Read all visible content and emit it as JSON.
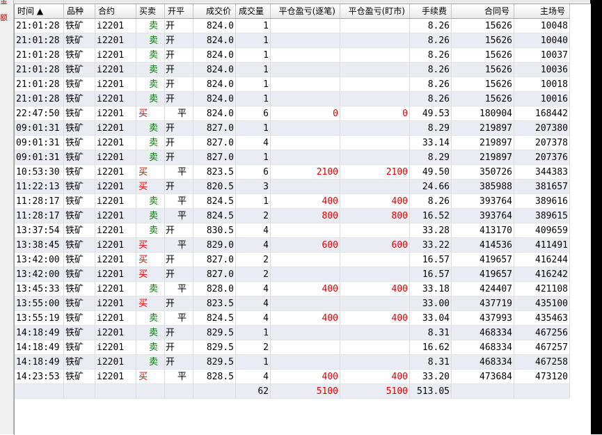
{
  "left_strip_chars": [
    "金",
    "额"
  ],
  "columns": [
    {
      "key": "time",
      "label": "时间 ▲",
      "w": 71,
      "align": "hl"
    },
    {
      "key": "variety",
      "label": "品种",
      "w": 45,
      "align": "hl"
    },
    {
      "key": "contract",
      "label": "合约",
      "w": 59,
      "align": "hl"
    },
    {
      "key": "bs",
      "label": "买卖",
      "w": 41,
      "align": "hl"
    },
    {
      "key": "oc",
      "label": "开平",
      "w": 41,
      "align": "hl"
    },
    {
      "key": "price",
      "label": "成交价",
      "w": 61,
      "align": "hr"
    },
    {
      "key": "qty",
      "label": "成交量",
      "w": 50,
      "align": "hl"
    },
    {
      "key": "pnl_trade",
      "label": "平仓盈亏(逐笔)",
      "w": 100,
      "align": "hr"
    },
    {
      "key": "pnl_mark",
      "label": "平仓盈亏(盯市)",
      "w": 100,
      "align": "hr"
    },
    {
      "key": "fee",
      "label": "手续费",
      "w": 60,
      "align": "hr"
    },
    {
      "key": "order_no",
      "label": "合同号",
      "w": 90,
      "align": "hr"
    },
    {
      "key": "venue_no",
      "label": "主场号",
      "w": 80,
      "align": "hr"
    }
  ],
  "rows": [
    {
      "time": "21:01:28",
      "variety": "铁矿",
      "contract": "i2201",
      "bs": "卖",
      "oc": "开",
      "price": "824.0",
      "qty": "1",
      "pnl_trade": "",
      "pnl_mark": "",
      "fee": "8.26",
      "order_no": "15626",
      "venue_no": "10048"
    },
    {
      "time": "21:01:28",
      "variety": "铁矿",
      "contract": "i2201",
      "bs": "卖",
      "oc": "开",
      "price": "824.0",
      "qty": "1",
      "pnl_trade": "",
      "pnl_mark": "",
      "fee": "8.26",
      "order_no": "15626",
      "venue_no": "10040"
    },
    {
      "time": "21:01:28",
      "variety": "铁矿",
      "contract": "i2201",
      "bs": "卖",
      "oc": "开",
      "price": "824.0",
      "qty": "1",
      "pnl_trade": "",
      "pnl_mark": "",
      "fee": "8.26",
      "order_no": "15626",
      "venue_no": "10037"
    },
    {
      "time": "21:01:28",
      "variety": "铁矿",
      "contract": "i2201",
      "bs": "卖",
      "oc": "开",
      "price": "824.0",
      "qty": "1",
      "pnl_trade": "",
      "pnl_mark": "",
      "fee": "8.26",
      "order_no": "15626",
      "venue_no": "10036"
    },
    {
      "time": "21:01:28",
      "variety": "铁矿",
      "contract": "i2201",
      "bs": "卖",
      "oc": "开",
      "price": "824.0",
      "qty": "1",
      "pnl_trade": "",
      "pnl_mark": "",
      "fee": "8.26",
      "order_no": "15626",
      "venue_no": "10018"
    },
    {
      "time": "21:01:28",
      "variety": "铁矿",
      "contract": "i2201",
      "bs": "卖",
      "oc": "开",
      "price": "824.0",
      "qty": "1",
      "pnl_trade": "",
      "pnl_mark": "",
      "fee": "8.26",
      "order_no": "15626",
      "venue_no": "10016"
    },
    {
      "time": "22:47:50",
      "variety": "铁矿",
      "contract": "i2201",
      "bs": "买",
      "oc": "平",
      "price": "824.0",
      "qty": "6",
      "pnl_trade": "0",
      "pnl_mark": "0",
      "fee": "49.53",
      "order_no": "180904",
      "venue_no": "168442"
    },
    {
      "time": "09:01:31",
      "variety": "铁矿",
      "contract": "i2201",
      "bs": "卖",
      "oc": "开",
      "price": "827.0",
      "qty": "1",
      "pnl_trade": "",
      "pnl_mark": "",
      "fee": "8.29",
      "order_no": "219897",
      "venue_no": "207380"
    },
    {
      "time": "09:01:31",
      "variety": "铁矿",
      "contract": "i2201",
      "bs": "卖",
      "oc": "开",
      "price": "827.0",
      "qty": "4",
      "pnl_trade": "",
      "pnl_mark": "",
      "fee": "33.14",
      "order_no": "219897",
      "venue_no": "207378"
    },
    {
      "time": "09:01:31",
      "variety": "铁矿",
      "contract": "i2201",
      "bs": "卖",
      "oc": "开",
      "price": "827.0",
      "qty": "1",
      "pnl_trade": "",
      "pnl_mark": "",
      "fee": "8.29",
      "order_no": "219897",
      "venue_no": "207376"
    },
    {
      "time": "10:53:30",
      "variety": "铁矿",
      "contract": "i2201",
      "bs": "买",
      "oc": "平",
      "price": "823.5",
      "qty": "6",
      "pnl_trade": "2100",
      "pnl_mark": "2100",
      "fee": "49.50",
      "order_no": "350726",
      "venue_no": "344383"
    },
    {
      "time": "11:22:13",
      "variety": "铁矿",
      "contract": "i2201",
      "bs": "买",
      "oc": "开",
      "price": "820.5",
      "qty": "3",
      "pnl_trade": "",
      "pnl_mark": "",
      "fee": "24.66",
      "order_no": "385988",
      "venue_no": "381657"
    },
    {
      "time": "11:28:17",
      "variety": "铁矿",
      "contract": "i2201",
      "bs": "卖",
      "oc": "平",
      "price": "824.5",
      "qty": "1",
      "pnl_trade": "400",
      "pnl_mark": "400",
      "fee": "8.26",
      "order_no": "393764",
      "venue_no": "389616"
    },
    {
      "time": "11:28:17",
      "variety": "铁矿",
      "contract": "i2201",
      "bs": "卖",
      "oc": "平",
      "price": "824.5",
      "qty": "2",
      "pnl_trade": "800",
      "pnl_mark": "800",
      "fee": "16.52",
      "order_no": "393764",
      "venue_no": "389615"
    },
    {
      "time": "13:37:54",
      "variety": "铁矿",
      "contract": "i2201",
      "bs": "卖",
      "oc": "开",
      "price": "830.5",
      "qty": "4",
      "pnl_trade": "",
      "pnl_mark": "",
      "fee": "33.28",
      "order_no": "413170",
      "venue_no": "409659"
    },
    {
      "time": "13:38:45",
      "variety": "铁矿",
      "contract": "i2201",
      "bs": "买",
      "oc": "平",
      "price": "829.0",
      "qty": "4",
      "pnl_trade": "600",
      "pnl_mark": "600",
      "fee": "33.22",
      "order_no": "414536",
      "venue_no": "411491"
    },
    {
      "time": "13:42:00",
      "variety": "铁矿",
      "contract": "i2201",
      "bs": "买",
      "oc": "开",
      "price": "827.0",
      "qty": "2",
      "pnl_trade": "",
      "pnl_mark": "",
      "fee": "16.57",
      "order_no": "419657",
      "venue_no": "416244"
    },
    {
      "time": "13:42:00",
      "variety": "铁矿",
      "contract": "i2201",
      "bs": "买",
      "oc": "开",
      "price": "827.0",
      "qty": "2",
      "pnl_trade": "",
      "pnl_mark": "",
      "fee": "16.57",
      "order_no": "419657",
      "venue_no": "416242"
    },
    {
      "time": "13:45:33",
      "variety": "铁矿",
      "contract": "i2201",
      "bs": "卖",
      "oc": "平",
      "price": "828.0",
      "qty": "4",
      "pnl_trade": "400",
      "pnl_mark": "400",
      "fee": "33.18",
      "order_no": "424407",
      "venue_no": "421108"
    },
    {
      "time": "13:55:00",
      "variety": "铁矿",
      "contract": "i2201",
      "bs": "买",
      "oc": "开",
      "price": "823.5",
      "qty": "4",
      "pnl_trade": "",
      "pnl_mark": "",
      "fee": "33.00",
      "order_no": "437719",
      "venue_no": "435100"
    },
    {
      "time": "13:55:19",
      "variety": "铁矿",
      "contract": "i2201",
      "bs": "卖",
      "oc": "平",
      "price": "824.5",
      "qty": "4",
      "pnl_trade": "400",
      "pnl_mark": "400",
      "fee": "33.04",
      "order_no": "437993",
      "venue_no": "435463"
    },
    {
      "time": "14:18:49",
      "variety": "铁矿",
      "contract": "i2201",
      "bs": "卖",
      "oc": "开",
      "price": "829.5",
      "qty": "1",
      "pnl_trade": "",
      "pnl_mark": "",
      "fee": "8.31",
      "order_no": "468334",
      "venue_no": "467256"
    },
    {
      "time": "14:18:49",
      "variety": "铁矿",
      "contract": "i2201",
      "bs": "卖",
      "oc": "开",
      "price": "829.5",
      "qty": "2",
      "pnl_trade": "",
      "pnl_mark": "",
      "fee": "16.62",
      "order_no": "468334",
      "venue_no": "467257"
    },
    {
      "time": "14:18:49",
      "variety": "铁矿",
      "contract": "i2201",
      "bs": "卖",
      "oc": "开",
      "price": "829.5",
      "qty": "1",
      "pnl_trade": "",
      "pnl_mark": "",
      "fee": "8.31",
      "order_no": "468334",
      "venue_no": "467258"
    },
    {
      "time": "14:23:53",
      "variety": "铁矿",
      "contract": "i2201",
      "bs": "买",
      "oc": "平",
      "price": "828.5",
      "qty": "4",
      "pnl_trade": "400",
      "pnl_mark": "400",
      "fee": "33.20",
      "order_no": "473684",
      "venue_no": "473120"
    }
  ],
  "totals": {
    "time": "",
    "variety": "",
    "contract": "",
    "bs": "",
    "oc": "",
    "price": "",
    "qty": "62",
    "pnl_trade": "5100",
    "pnl_mark": "5100",
    "fee": "513.05",
    "order_no": "",
    "venue_no": ""
  },
  "colors": {
    "buy": "#e00000",
    "sell": "#008000",
    "profit": "#e00000",
    "row_alt": "#e9edf3"
  }
}
